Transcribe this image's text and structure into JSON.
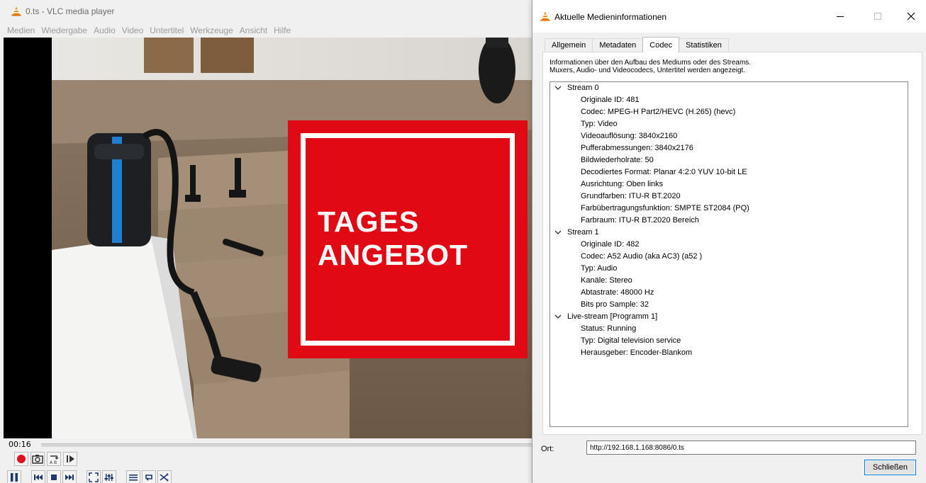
{
  "vlc": {
    "title": "0.ts - VLC media player",
    "menu": [
      "Medien",
      "Wiedergabe",
      "Audio",
      "Video",
      "Untertitel",
      "Werkzeuge",
      "Ansicht",
      "Hilfe"
    ],
    "time_current": "00:16",
    "promo_line1": "TAGES",
    "promo_line2": "ANGEBOT",
    "brand_red": "#e10a14"
  },
  "dialog": {
    "title": "Aktuelle Medieninformationen",
    "tabs": [
      "Allgemein",
      "Metadaten",
      "Codec",
      "Statistiken"
    ],
    "active_tab": "Codec",
    "description_line1": "Informationen über den Aufbau des Mediums oder des Streams.",
    "description_line2": "Muxers, Audio- und Videocodecs, Untertitel werden angezeigt.",
    "streams": [
      {
        "label": "Stream 0",
        "items": [
          "Originale ID: 481",
          "Codec: MPEG-H Part2/HEVC (H.265) (hevc)",
          "Typ: Video",
          "Videoauflösung: 3840x2160",
          "Pufferabmessungen: 3840x2176",
          "Bildwiederholrate: 50",
          "Decodiertes Format: Planar 4:2:0 YUV 10-bit LE",
          "Ausrichtung: Oben links",
          "Grundfarben: ITU-R BT.2020",
          "Farbübertragungsfunktion: SMPTE ST2084 (PQ)",
          "Farbraum: ITU-R BT.2020 Bereich"
        ]
      },
      {
        "label": "Stream 1",
        "items": [
          "Originale ID: 482",
          "Codec: A52 Audio (aka AC3) (a52 )",
          "Typ: Audio",
          "Kanäle: Stereo",
          "Abtastrate: 48000 Hz",
          "Bits pro Sample: 32"
        ]
      },
      {
        "label": "Live-stream [Programm 1]",
        "items": [
          "Status: Running",
          "Typ: Digital television service",
          "Herausgeber: Encoder-Blankom"
        ]
      }
    ],
    "location_label": "Ort:",
    "location_value": "http://192.168.1.168:8086/0.ts",
    "close_label": "Schließen"
  }
}
